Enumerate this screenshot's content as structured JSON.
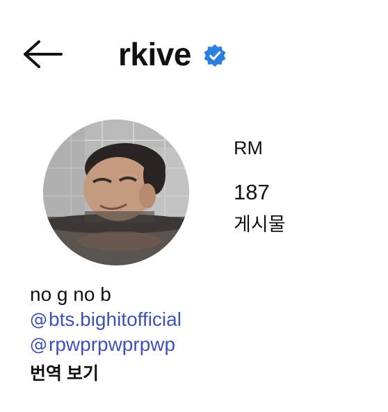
{
  "header": {
    "username": "rkive",
    "back_icon": "arrow-left-icon",
    "verified_icon": "verified-badge-icon",
    "verified_color": "#2b7fe0"
  },
  "profile": {
    "display_name": "RM",
    "post_count": "187",
    "post_label": "게시물",
    "avatar": "profile-photo"
  },
  "bio": {
    "text": "no g no b",
    "links": [
      {
        "icon": "threads-icon",
        "glyph": "@",
        "label": "bts.bighitofficial"
      },
      {
        "icon": "threads-icon",
        "glyph": "@",
        "label": "rpwprpwprpwp"
      }
    ],
    "link_color": "#3f51b5",
    "translate_label": "번역 보기"
  }
}
